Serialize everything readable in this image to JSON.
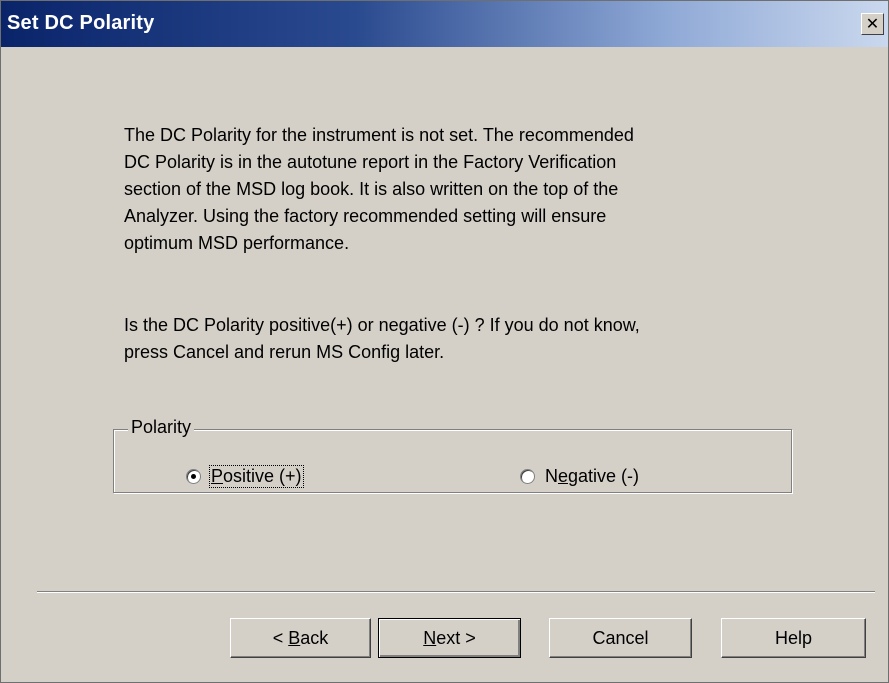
{
  "window": {
    "title": "Set DC Polarity",
    "close_glyph": "✕"
  },
  "message": {
    "paragraph1_lines": [
      "The DC Polarity for the instrument is not set.  The recommended",
      "DC Polarity is in the autotune report in the Factory Verification",
      "section of the MSD log book.  It is also written on the top of the",
      "Analyzer.  Using the factory recommended setting will ensure",
      "optimum MSD performance."
    ],
    "paragraph2_lines": [
      "Is the DC Polarity positive(+) or negative (-) ?  If you do not know,",
      "press Cancel and rerun MS Config later."
    ]
  },
  "polarity_group": {
    "legend": "Polarity",
    "selected": "positive",
    "positive": {
      "mnemonic": "P",
      "label_rest": "ositive (+)"
    },
    "negative": {
      "label_before": "N",
      "mnemonic": "e",
      "label_rest": "gative (-)"
    }
  },
  "buttons": {
    "back": {
      "prefix": "< ",
      "mnemonic": "B",
      "rest": "ack"
    },
    "next": {
      "mnemonic": "N",
      "rest": "ext >"
    },
    "cancel": "Cancel",
    "help": "Help"
  }
}
